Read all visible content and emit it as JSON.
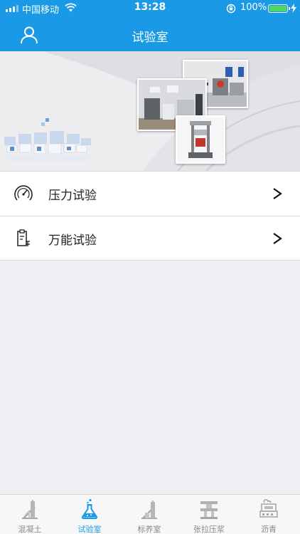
{
  "status": {
    "carrier": "中国移动",
    "time": "13:28",
    "battery": "100%"
  },
  "nav": {
    "title": "试验室"
  },
  "menu": {
    "items": [
      {
        "label": "压力试验",
        "icon": "pressure-gauge-icon",
        "chevron": ">"
      },
      {
        "label": "万能试验",
        "icon": "universal-test-document-icon",
        "chevron": ">"
      }
    ]
  },
  "tabbar": {
    "active_color": "#1a9ae6",
    "tabs": [
      {
        "label": "混凝土",
        "icon": "concrete-tower-icon",
        "active": false
      },
      {
        "label": "试验室",
        "icon": "flask-icon",
        "active": true
      },
      {
        "label": "标养室",
        "icon": "curing-room-icon",
        "active": false
      },
      {
        "label": "张拉压浆",
        "icon": "tension-grouting-icon",
        "active": false
      },
      {
        "label": "沥青",
        "icon": "asphalt-plant-icon",
        "active": false
      }
    ]
  },
  "colors": {
    "primary": "#1a9ae6",
    "background": "#f0eff4"
  }
}
